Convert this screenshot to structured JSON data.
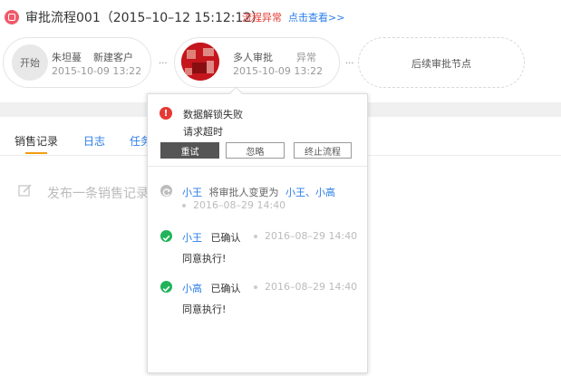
{
  "header": {
    "title": "审批流程001（2015–10–12 15:12:12）",
    "status": "流程异常",
    "link": "点击查看>>"
  },
  "flow": {
    "start": {
      "circle_label": "开始",
      "person": "朱坦蔓",
      "action": "新建客户",
      "time": "2015-10-09 13:22"
    },
    "node2": {
      "title": "多人审批",
      "status": "异常",
      "time": "2015-10-09 13:22"
    },
    "ellipsis": "...",
    "next": "后续审批节点"
  },
  "tabs": {
    "sales": "销售记录",
    "log": "日志",
    "task": "任务"
  },
  "compose": {
    "placeholder": "发布一条销售记录"
  },
  "popup": {
    "error_title": "数据解锁失败",
    "error_sub": "请求超时",
    "error_icon": "!",
    "buttons": {
      "retry": "重试",
      "ignore": "忽略",
      "stop": "终止流程"
    },
    "events": [
      {
        "actor": "小王",
        "action": "将审批人变更为",
        "targets": "小王、小高",
        "time": "2016–08–29 14:40",
        "icon": "refresh-icon"
      },
      {
        "actor": "小王",
        "action": "已确认",
        "time": "2016–08–29 14:40",
        "comment": "同意执行!",
        "icon": "check-icon"
      },
      {
        "actor": "小高",
        "action": "已确认",
        "time": "2016–08–29 14:40",
        "comment": "同意执行!",
        "icon": "check-icon"
      }
    ]
  },
  "colors": {
    "error": "#e53935",
    "link": "#2b7de9",
    "success": "#21b35a",
    "tab_accent": "#f39c12"
  }
}
